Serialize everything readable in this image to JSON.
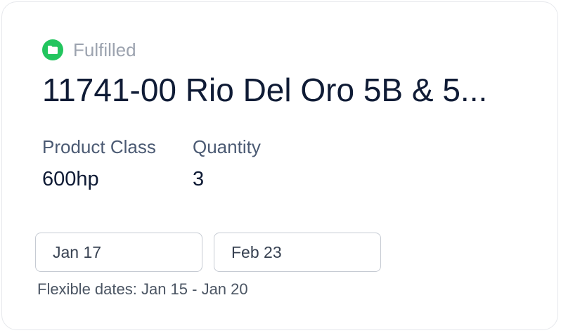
{
  "order": {
    "status": "Fulfilled",
    "status_icon": "folder-icon",
    "status_color": "#22c55e",
    "title": "11741-00 Rio Del Oro 5B & 5...",
    "fields": [
      {
        "label": "Product Class",
        "value": "600hp"
      },
      {
        "label": "Quantity",
        "value": "3"
      }
    ],
    "dates": {
      "start": "Jan 17",
      "end": "Feb 23",
      "flexible_note": "Flexible dates: Jan 15 - Jan 20"
    }
  }
}
